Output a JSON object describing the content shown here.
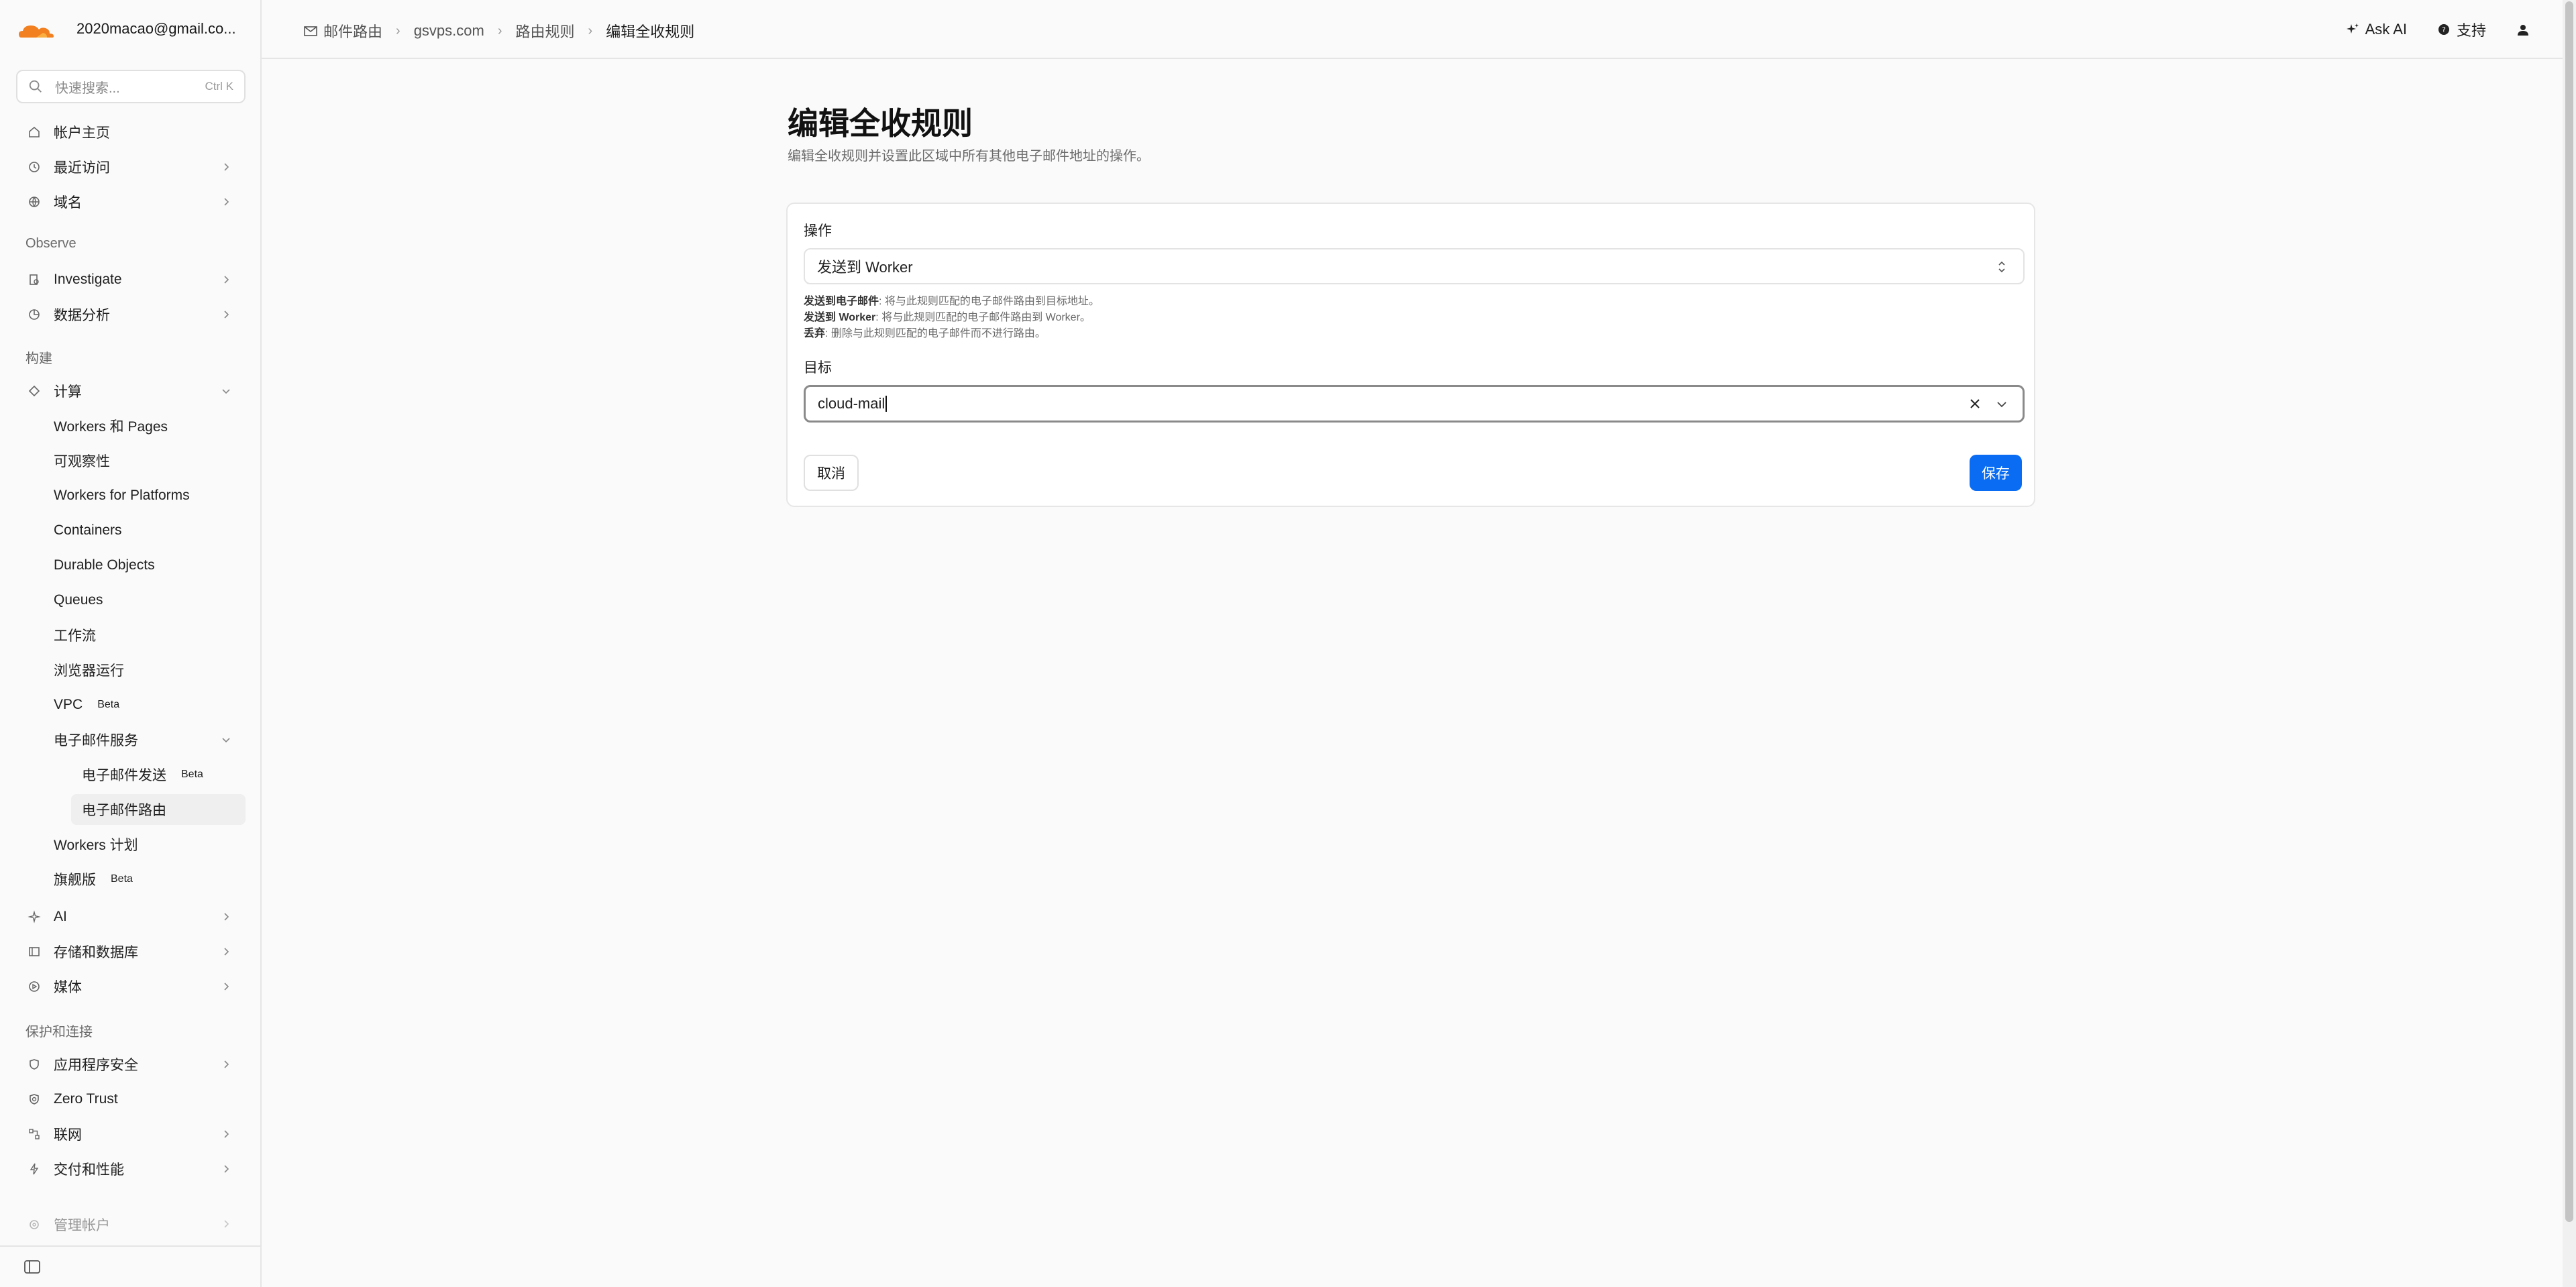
{
  "account": "2020macao@gmail.co...",
  "search": {
    "placeholder": "快速搜索...",
    "shortcut": "Ctrl K"
  },
  "nav": {
    "home": "帐户主页",
    "recent": "最近访问",
    "domains": "域名",
    "section_observe": "Observe",
    "investigate": "Investigate",
    "analytics": "数据分析",
    "section_build": "构建",
    "compute": "计算",
    "workers_pages": "Workers 和 Pages",
    "observability": "可观察性",
    "workers_platforms": "Workers for Platforms",
    "containers": "Containers",
    "durable_objects": "Durable Objects",
    "queues": "Queues",
    "workflows": "工作流",
    "browser_run": "浏览器运行",
    "vpc": "VPC",
    "vpc_badge": "Beta",
    "email_service": "电子邮件服务",
    "email_send": "电子邮件发送",
    "email_send_badge": "Beta",
    "email_routing": "电子邮件路由",
    "workers_plans": "Workers 计划",
    "flagship": "旗舰版",
    "flagship_badge": "Beta",
    "ai": "AI",
    "storage": "存储和数据库",
    "media": "媒体",
    "section_protect": "保护和连接",
    "app_security": "应用程序安全",
    "zero_trust": "Zero Trust",
    "networking": "联网",
    "delivery": "交付和性能",
    "manage_account": "管理帐户"
  },
  "breadcrumb": {
    "email_routing": "邮件路由",
    "domain": "gsvps.com",
    "routing_rules": "路由规则",
    "current": "编辑全收规则"
  },
  "top_actions": {
    "ask_ai": "Ask AI",
    "support": "支持"
  },
  "page": {
    "title": "编辑全收规则",
    "description": "编辑全收规则并设置此区域中所有其他电子邮件地址的操作。"
  },
  "form": {
    "action_label": "操作",
    "action_value": "发送到 Worker",
    "help": [
      {
        "term": "发送到电子邮件",
        "text": ": 将与此规则匹配的电子邮件路由到目标地址。"
      },
      {
        "term": "发送到 Worker",
        "text": ": 将与此规则匹配的电子邮件路由到 Worker。"
      },
      {
        "term": "丢弃",
        "text": ": 删除与此规则匹配的电子邮件而不进行路由。"
      }
    ],
    "target_label": "目标",
    "target_value": "cloud-mail",
    "cancel": "取消",
    "save": "保存"
  },
  "colors": {
    "accent": "#0a6cf2",
    "brand": "#f38020"
  }
}
